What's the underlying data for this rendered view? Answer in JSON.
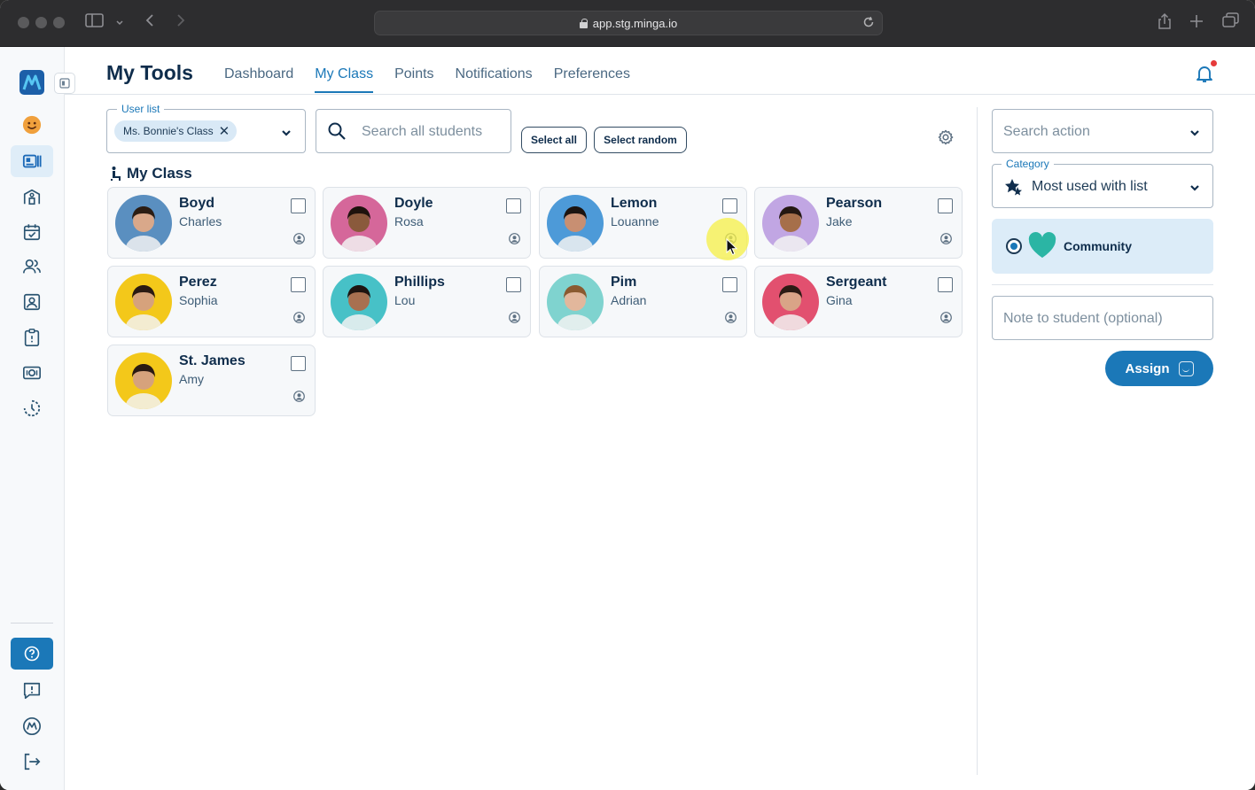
{
  "browser": {
    "url": "app.stg.minga.io"
  },
  "header": {
    "title": "My Tools",
    "tabs": [
      {
        "label": "Dashboard",
        "active": false
      },
      {
        "label": "My Class",
        "active": true
      },
      {
        "label": "Points",
        "active": false
      },
      {
        "label": "Notifications",
        "active": false
      },
      {
        "label": "Preferences",
        "active": false
      }
    ]
  },
  "sidebar": {
    "items": [
      "minga-logo-icon",
      "smiley-icon",
      "id-card-icon",
      "school-icon",
      "calendar-check-icon",
      "people-icon",
      "portrait-icon",
      "clipboard-icon",
      "ticket-icon",
      "progress-icon"
    ],
    "bottom_items": [
      "help-icon",
      "feedback-icon",
      "minga-badge-icon",
      "logout-icon"
    ]
  },
  "filters": {
    "user_list_label": "User list",
    "user_list_chip": "Ms. Bonnie's Class",
    "search_placeholder": "Search all students",
    "select_all": "Select all",
    "select_random": "Select random"
  },
  "section_title": "My Class",
  "students": [
    {
      "last": "Boyd",
      "first": "Charles",
      "bg": "#5a8fc0",
      "skin": "#d9a88a",
      "hair": "#2b1d14"
    },
    {
      "last": "Doyle",
      "first": "Rosa",
      "bg": "#d5679a",
      "skin": "#8a5a3c",
      "hair": "#1e130d"
    },
    {
      "last": "Lemon",
      "first": "Louanne",
      "bg": "#4d9ad8",
      "skin": "#c88f72",
      "hair": "#1c1410"
    },
    {
      "last": "Pearson",
      "first": "Jake",
      "bg": "#c1a6e3",
      "skin": "#a66f4a",
      "hair": "#241812"
    },
    {
      "last": "Perez",
      "first": "Sophia",
      "bg": "#f3c81a",
      "skin": "#d6a27c",
      "hair": "#2a1a12"
    },
    {
      "last": "Phillips",
      "first": "Lou",
      "bg": "#47c1c7",
      "skin": "#a87050",
      "hair": "#1e1410"
    },
    {
      "last": "Pim",
      "first": "Adrian",
      "bg": "#7fd3cf",
      "skin": "#e2b79c",
      "hair": "#8a5a30"
    },
    {
      "last": "Sergeant",
      "first": "Gina",
      "bg": "#e2506f",
      "skin": "#d9a487",
      "hair": "#2c1b14"
    },
    {
      "last": "St. James",
      "first": "Amy",
      "bg": "#f3c81a",
      "skin": "#d6a27c",
      "hair": "#2a1a12"
    }
  ],
  "right_panel": {
    "search_action_placeholder": "Search action",
    "category_label": "Category",
    "category_value": "Most used with list",
    "selected_action": "Community",
    "note_placeholder": "Note to student (optional)",
    "assign_label": "Assign"
  },
  "colors": {
    "accent": "#1b78b8",
    "heading": "#0f2d4c",
    "community_bg": "#dcecf8",
    "heart": "#2bb5a4"
  }
}
